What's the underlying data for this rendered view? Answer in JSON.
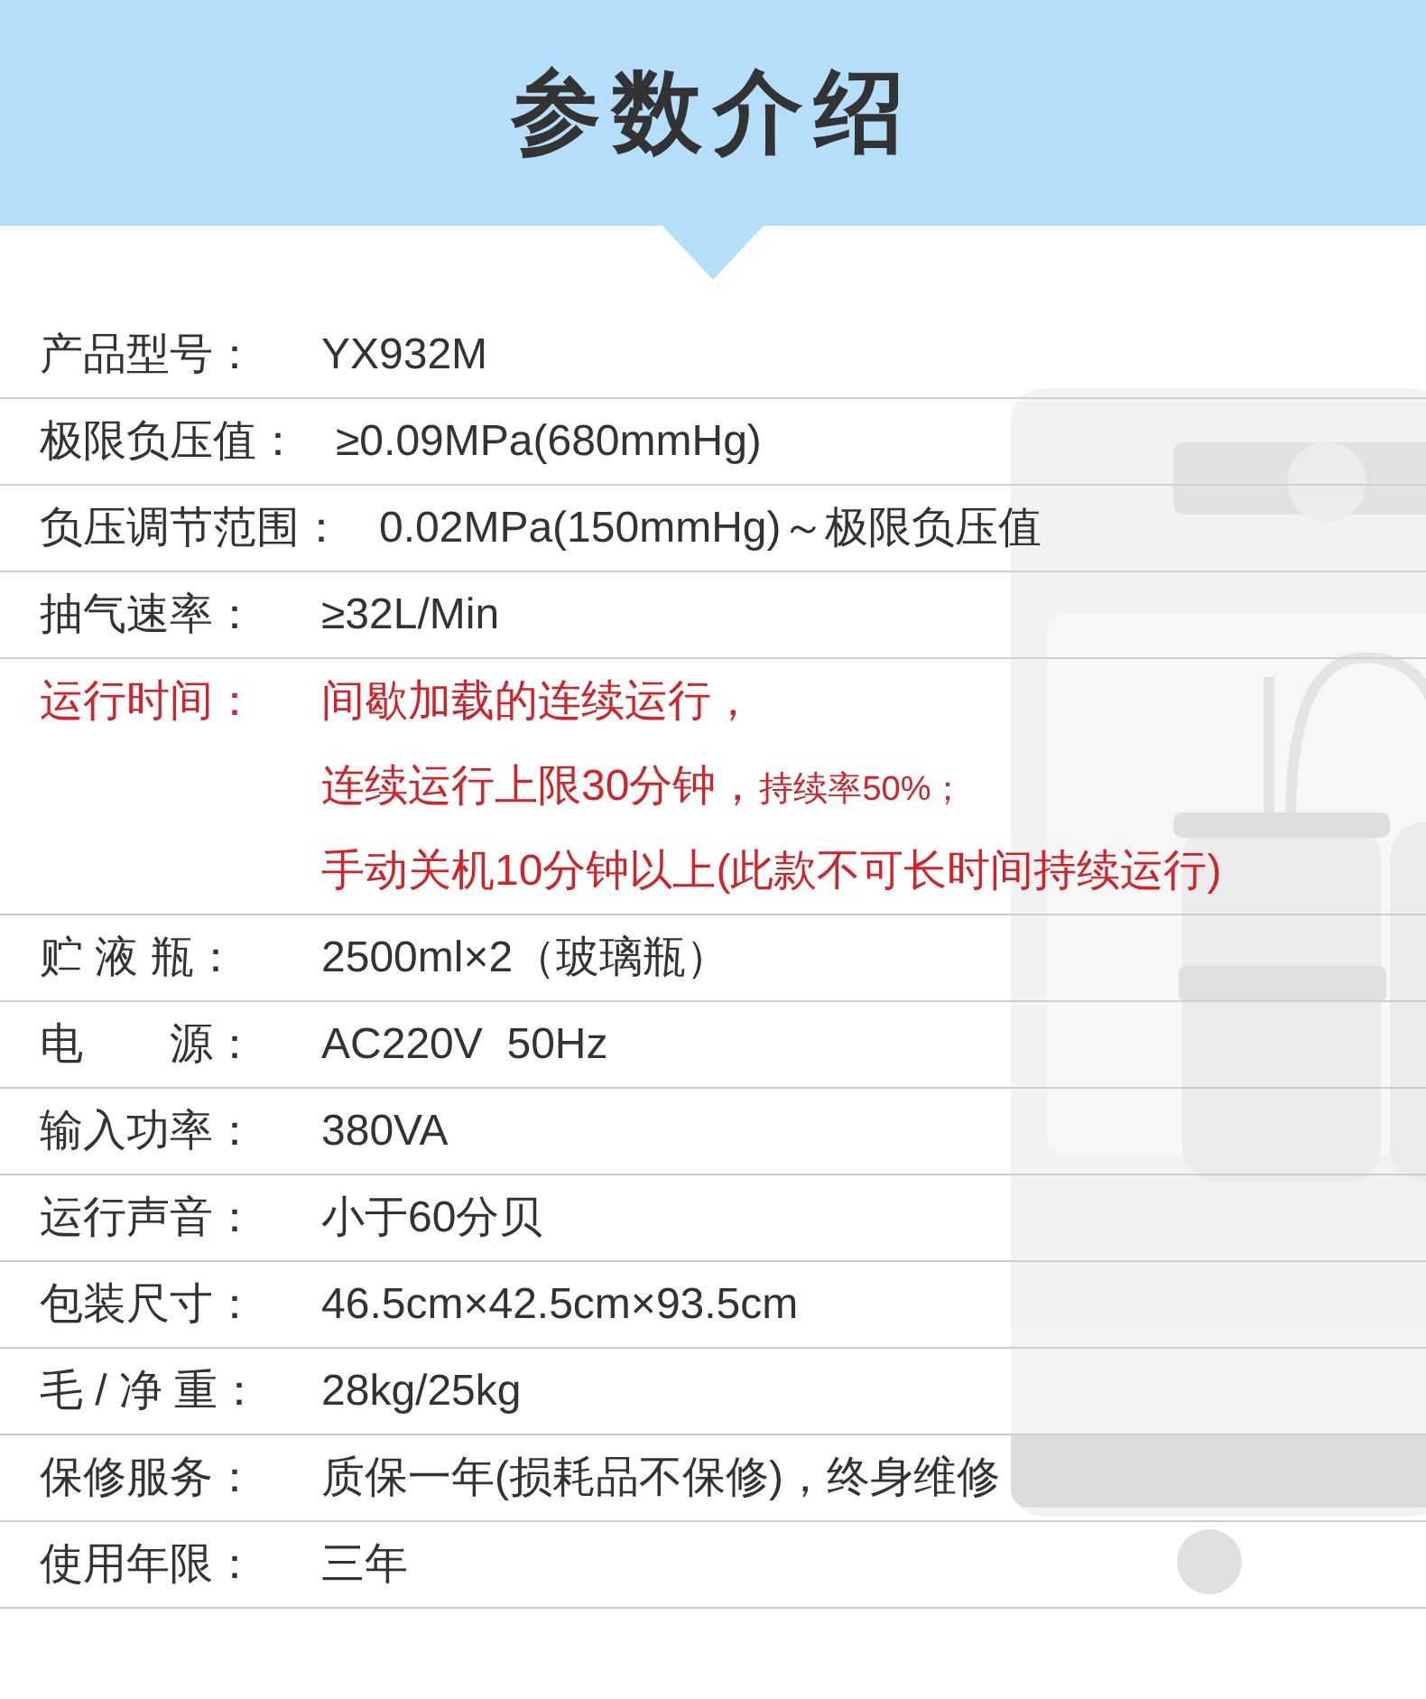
{
  "header": {
    "title": "参数介绍"
  },
  "specs": [
    {
      "label": "产品型号：",
      "highlight": false,
      "lines": [
        [
          {
            "text": "YX932M",
            "small": false
          }
        ]
      ]
    },
    {
      "label": "极限负压值：",
      "highlight": false,
      "lines": [
        [
          {
            "text": "≥0.09MPa(680mmHg)",
            "small": false
          }
        ]
      ]
    },
    {
      "label": "负压调节范围：",
      "highlight": false,
      "lines": [
        [
          {
            "text": "0.02MPa(150mmHg)～极限负压值",
            "small": false
          }
        ]
      ]
    },
    {
      "label": "抽气速率：",
      "highlight": false,
      "lines": [
        [
          {
            "text": "≥32L/Min",
            "small": false
          }
        ]
      ]
    },
    {
      "label": "运行时间：",
      "highlight": true,
      "lines": [
        [
          {
            "text": "间歇加载的连续运行，",
            "small": false
          }
        ],
        [
          {
            "text": "连续运行上限30分钟，",
            "small": false
          },
          {
            "text": "持续率50%；",
            "small": true
          }
        ],
        [
          {
            "text": "手动关机10分钟以上(此款不可长时间持续运行)",
            "small": false
          }
        ]
      ]
    },
    {
      "label": "贮 液 瓶：",
      "highlight": false,
      "lines": [
        [
          {
            "text": "2500ml×2（玻璃瓶）",
            "small": false
          }
        ]
      ]
    },
    {
      "label": "电　　源：",
      "highlight": false,
      "lines": [
        [
          {
            "text": "AC220V  50Hz",
            "small": false
          }
        ]
      ]
    },
    {
      "label": "输入功率：",
      "highlight": false,
      "lines": [
        [
          {
            "text": "380VA",
            "small": false
          }
        ]
      ]
    },
    {
      "label": "运行声音：",
      "highlight": false,
      "lines": [
        [
          {
            "text": "小于60分贝",
            "small": false
          }
        ]
      ]
    },
    {
      "label": "包装尺寸：",
      "highlight": false,
      "lines": [
        [
          {
            "text": "46.5cm×42.5cm×93.5cm",
            "small": false
          }
        ]
      ]
    },
    {
      "label": "毛 / 净 重：",
      "highlight": false,
      "lines": [
        [
          {
            "text": "28kg/25kg",
            "small": false
          }
        ]
      ]
    },
    {
      "label": "保修服务：",
      "highlight": false,
      "lines": [
        [
          {
            "text": "质保一年(损耗品不保修)，终身维修",
            "small": false
          }
        ]
      ]
    },
    {
      "label": "使用年限：",
      "highlight": false,
      "lines": [
        [
          {
            "text": "三年",
            "small": false
          }
        ]
      ]
    }
  ]
}
